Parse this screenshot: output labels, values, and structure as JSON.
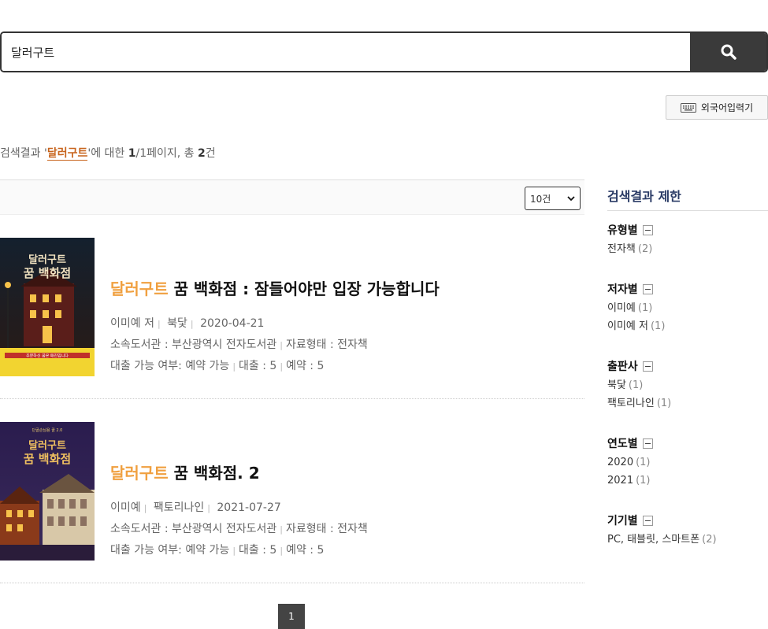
{
  "search": {
    "value": "달러구트"
  },
  "foreign_input_label": "외국어입력기",
  "summary": {
    "prefix": "검색결과 '",
    "keyword": "달러구트",
    "mid": "'에 대한 ",
    "page": "1",
    "page_rest": "/1페이지, 총 ",
    "total": "2",
    "suffix": "건"
  },
  "per_page": "10건",
  "results": [
    {
      "title_highlight": "달러구트",
      "title_rest": " 꿈 백화점 : 잠들어야만 입장 가능합니다",
      "author": "이미예 저",
      "publisher": "북닻",
      "date": "2020-04-21",
      "library": "소속도서관 : 부산광역시 전자도서관",
      "format": "자료형태 : 전자책",
      "availability": "대출 가능 여부: 예약 가능",
      "loans": "대출 : 5",
      "reservations": "예약 : 5"
    },
    {
      "title_highlight": "달러구트",
      "title_rest": " 꿈 백화점. 2",
      "author": "이미예",
      "publisher": "팩토리나인",
      "date": "2021-07-27",
      "library": "소속도서관 : 부산광역시 전자도서관",
      "format": "자료형태 : 전자책",
      "availability": "대출 가능 여부: 예약 가능",
      "loans": "대출 : 5",
      "reservations": "예약 : 5"
    }
  ],
  "pagination": {
    "current": "1"
  },
  "facets": {
    "title": "검색결과 제한",
    "groups": [
      {
        "name": "유형별",
        "items": [
          {
            "label": "전자책",
            "count": "(2)"
          }
        ]
      },
      {
        "name": "저자별",
        "items": [
          {
            "label": "이미예",
            "count": "(1)"
          },
          {
            "label": "이미예 저",
            "count": "(1)"
          }
        ]
      },
      {
        "name": "출판사",
        "items": [
          {
            "label": "북닻",
            "count": "(1)"
          },
          {
            "label": "팩토리나인",
            "count": "(1)"
          }
        ]
      },
      {
        "name": "연도별",
        "items": [
          {
            "label": "2020",
            "count": "(1)"
          },
          {
            "label": "2021",
            "count": "(1)"
          }
        ]
      },
      {
        "name": "기기별",
        "items": [
          {
            "label": "PC, 태블릿, 스마트폰",
            "count": "(2)"
          }
        ]
      }
    ]
  },
  "covers": [
    {
      "top_text": "주문하신 꿈은 매진입니다",
      "title_line1": "달러구트",
      "title_line2": "꿈 백화점",
      "accent": "#f2d430"
    },
    {
      "top_text": "단골손님용 꿈 2.0",
      "title_line1": "달러구트",
      "title_line2": "꿈 백화점",
      "accent": "#f0c060"
    }
  ]
}
